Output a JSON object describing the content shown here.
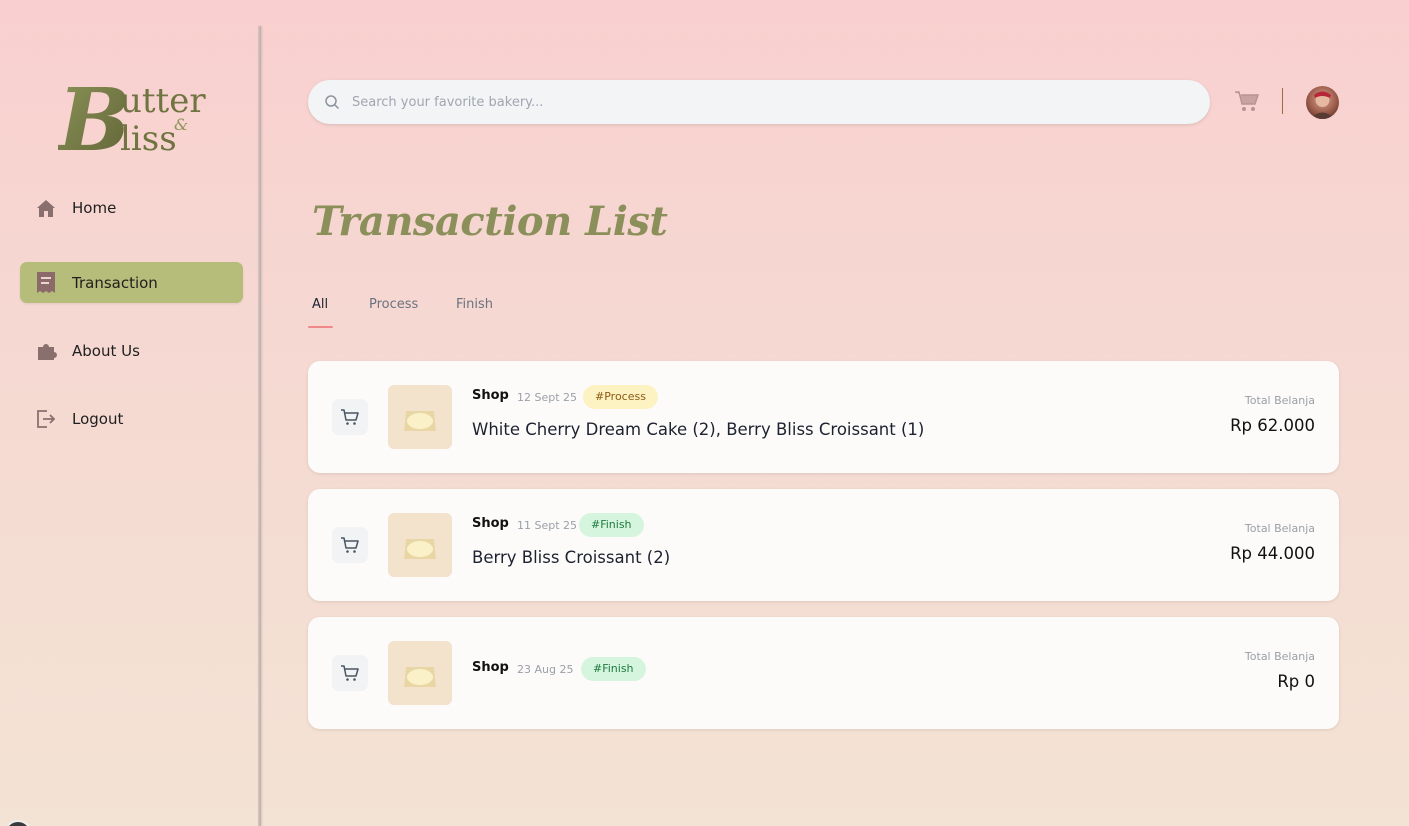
{
  "brand": {
    "logo_text": "Butter & Bliss"
  },
  "sidebar": {
    "items": [
      {
        "label": "Home"
      },
      {
        "label": "Transaction"
      },
      {
        "label": "About Us"
      },
      {
        "label": "Logout"
      }
    ]
  },
  "search": {
    "placeholder": "Search your favorite bakery...",
    "value": ""
  },
  "page": {
    "title": "Transaction List"
  },
  "tabs": [
    {
      "label": "All"
    },
    {
      "label": "Process"
    },
    {
      "label": "Finish"
    }
  ],
  "transactions": [
    {
      "shop": "Shop",
      "date": "12 Sept 25",
      "status": "#Process",
      "items": "White Cherry Dream Cake (2), Berry Bliss Croissant (1)",
      "total_label": "Total Belanja",
      "total": "Rp 62.000"
    },
    {
      "shop": "Shop",
      "date": "11 Sept 25",
      "status": "#Finish",
      "items": "Berry Bliss Croissant (2)",
      "total_label": "Total Belanja",
      "total": "Rp 44.000"
    },
    {
      "shop": "Shop",
      "date": "23 Aug 25",
      "status": "#Finish",
      "items": "",
      "total_label": "Total Belanja",
      "total": "Rp 0"
    }
  ],
  "colors": {
    "accent_active_nav": "#b6bc7a",
    "title_olive": "#8b8f5a",
    "badge_process_bg": "#fdf2c2",
    "badge_finish_bg": "#d6f5df",
    "tab_underline": "#f08a8a"
  }
}
